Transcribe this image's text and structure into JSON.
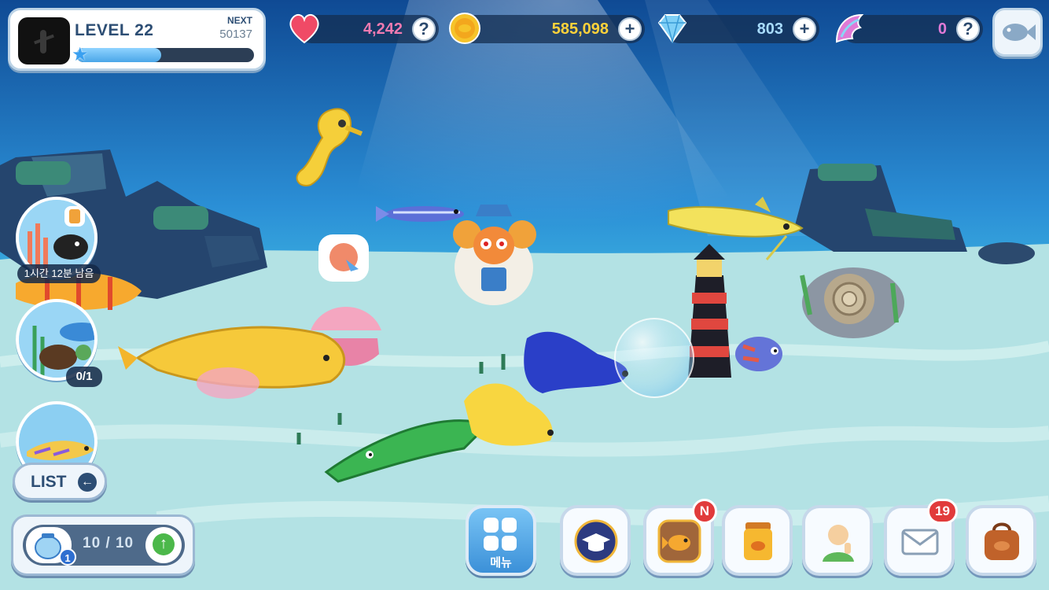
{
  "player": {
    "level_label": "LEVEL 22",
    "next_label": "NEXT",
    "next_value": "50137",
    "xp_progress": 0.48
  },
  "resources": {
    "hearts": {
      "value": "4,242",
      "button": "?",
      "icon": "heart-icon",
      "color": "#f0609a"
    },
    "coins": {
      "value": "585,098",
      "button": "+",
      "icon": "coin-icon",
      "color": "#ffd23a"
    },
    "gems": {
      "value": "803",
      "button": "+",
      "icon": "diamond-icon",
      "color": "#9fd9ff"
    },
    "wings": {
      "value": "0",
      "button": "?",
      "icon": "wing-icon",
      "color": "#e07ad6"
    }
  },
  "side": {
    "timer_text": "1시간 12분 남음",
    "count_text": "0/1",
    "list_label": "LIST"
  },
  "tank": {
    "capacity": "10 / 10",
    "badge": "1"
  },
  "menu": {
    "label": "메뉴",
    "buttons": [
      {
        "name": "academy-button",
        "icon": "graduation-cap-icon",
        "badge": ""
      },
      {
        "name": "fish-book-button",
        "icon": "goldfish-icon",
        "badge": "N"
      },
      {
        "name": "fish-jar-button",
        "icon": "jar-icon",
        "badge": ""
      },
      {
        "name": "friends-button",
        "icon": "person-icon",
        "badge": ""
      },
      {
        "name": "mail-button",
        "icon": "envelope-icon",
        "badge": "19"
      },
      {
        "name": "bag-button",
        "icon": "bag-icon",
        "badge": ""
      }
    ]
  },
  "colors": {
    "ocean_top": "#1b5ea8",
    "ocean_mid": "#2f98d8",
    "sand": "#bfe6e6"
  }
}
